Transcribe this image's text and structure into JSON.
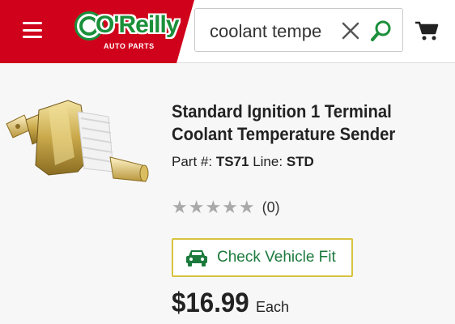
{
  "header": {
    "brand": {
      "name": "O'Reilly",
      "tagline": "AUTO PARTS"
    },
    "search": {
      "value": "coolant tempe"
    },
    "icons": {
      "menu": "hamburger-menu-icon",
      "clear": "close-icon",
      "search": "search-icon",
      "cart": "cart-icon"
    },
    "colors": {
      "brand_red": "#d0021b",
      "brand_green": "#1b8f3a"
    }
  },
  "product": {
    "title_line1": "Standard Ignition 1 Terminal",
    "title_line2": "Coolant Temperature Sender",
    "part_label": "Part #:",
    "part_number": "TS71",
    "line_label": "Line:",
    "line_value": "STD",
    "stars": "★★★★★",
    "rating_count": "(0)",
    "fit_button_label": "Check Vehicle Fit",
    "price": "$16.99",
    "price_unit": "Each"
  }
}
